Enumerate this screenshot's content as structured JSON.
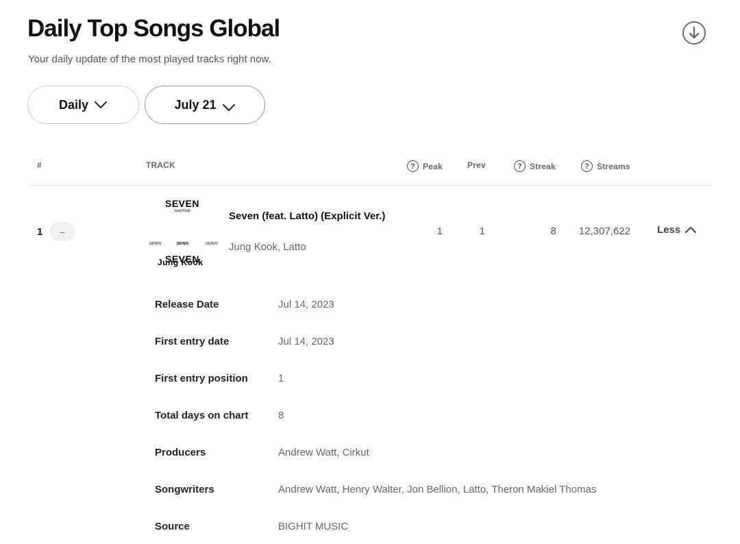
{
  "header": {
    "title": "Daily Top Songs Global",
    "subtitle": "Your daily update of the most played tracks right now."
  },
  "filters": {
    "period": "Daily",
    "date": "July 21"
  },
  "table": {
    "headers": {
      "rank": "#",
      "track": "TRACK",
      "peak": "Peak",
      "prev": "Prev",
      "streak": "Streak",
      "streams": "Streams"
    },
    "rows": [
      {
        "rank": "1",
        "change": "–",
        "title": "Seven (feat. Latto) (Explicit Ver.)",
        "artists": "Jung Kook, Latto",
        "peak": "1",
        "prev": "1",
        "streak": "8",
        "streams": "12,307,622",
        "toggle_label": "Less",
        "cover": {
          "top_text": "SEVEN",
          "top_sub": "Jung Kook",
          "mid_left": "SEVEN",
          "mid_center": "SEVEN",
          "mid_right": "SEVEN",
          "bottom_text": "SEVEN",
          "bottom_overlap": "Jung Kook"
        }
      }
    ]
  },
  "details": [
    {
      "label": "Release Date",
      "value": "Jul 14, 2023"
    },
    {
      "label": "First entry date",
      "value": "Jul 14, 2023"
    },
    {
      "label": "First entry position",
      "value": "1"
    },
    {
      "label": "Total days on chart",
      "value": "8"
    },
    {
      "label": "Producers",
      "value": "Andrew Watt, Cirkut"
    },
    {
      "label": "Songwriters",
      "value": "Andrew Watt, Henry Walter, Jon Bellion, Latto, Theron Makiel Thomas"
    },
    {
      "label": "Source",
      "value": "BIGHIT MUSIC"
    }
  ],
  "icons": {
    "download": "download-circle-icon",
    "dropdown": "chevron-down-icon",
    "help": "question-circle-icon",
    "collapse": "chevron-up-icon"
  }
}
